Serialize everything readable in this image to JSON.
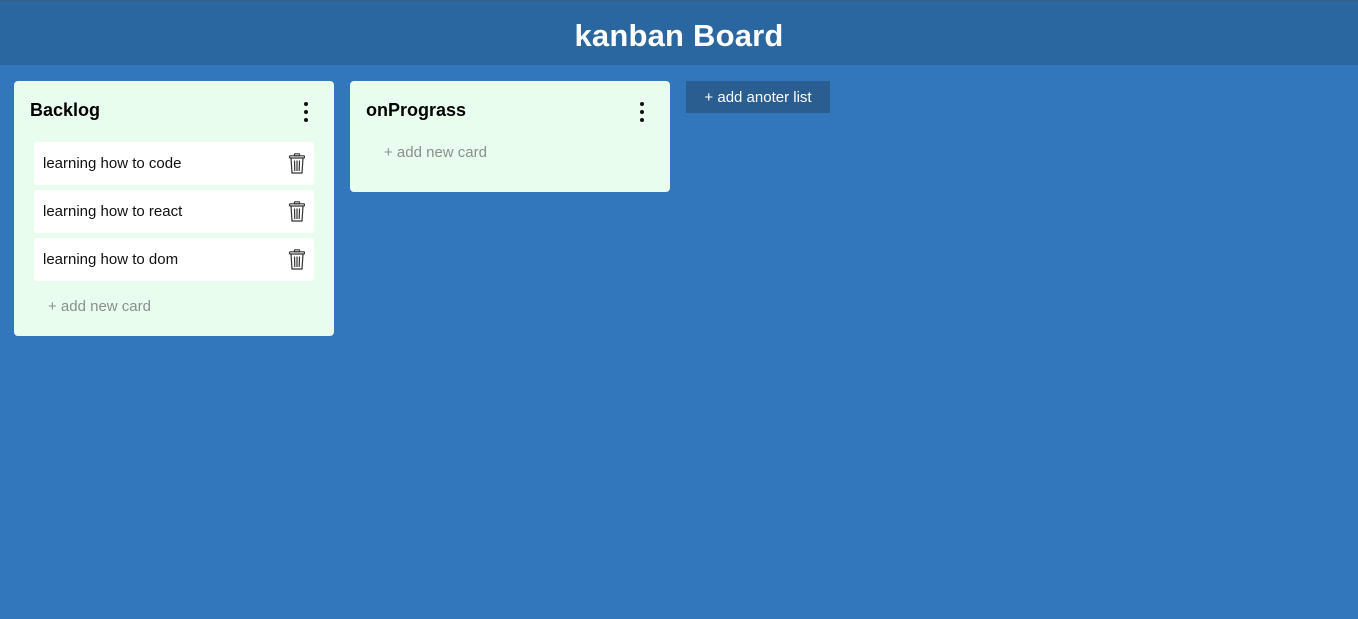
{
  "header": {
    "title": "kanban Board"
  },
  "lists": [
    {
      "title": "Backlog",
      "cards": [
        {
          "text": "learning how to code"
        },
        {
          "text": "learning how to react"
        },
        {
          "text": "learning how to dom"
        }
      ],
      "add_card_label": "+ add new card"
    },
    {
      "title": "onPrograss",
      "cards": [],
      "add_card_label": "+ add new card"
    }
  ],
  "add_list_label": "+ add anoter list",
  "icons": {
    "list_menu": "vertical-dots-icon",
    "card_delete": "trash-icon"
  },
  "colors": {
    "background": "#3277bc",
    "header": "#2a67a0",
    "list_background": "#e9fdef",
    "card_background": "#ffffff",
    "add_list_button": "#2a5e91"
  }
}
